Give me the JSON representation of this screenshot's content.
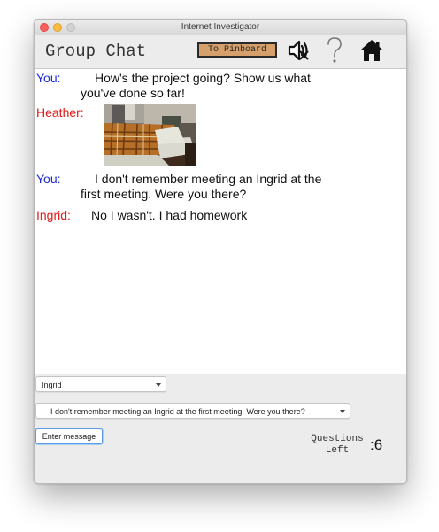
{
  "window": {
    "title": "Internet Investigator"
  },
  "header": {
    "title": "Group Chat",
    "pinboard_label": "To Pinboard",
    "icons": [
      "speaker-muted-icon",
      "question-mark-icon",
      "home-icon"
    ]
  },
  "colors": {
    "you": "#1a2ad6",
    "others": "#e01a1a",
    "pinboard_button": "#d6a06c"
  },
  "messages": [
    {
      "sender": "You:",
      "line1": "How's the project going? Show us what",
      "line2": "you've done so far!"
    },
    {
      "sender": "Heather:",
      "attachment": "photo-of-bedroom"
    },
    {
      "sender": "You:",
      "line1": "I don't remember meeting an Ingrid at the",
      "line2": "first meeting. Were you there?"
    },
    {
      "sender": "Ingrid:",
      "line1": "No I wasn't. I had homework"
    }
  ],
  "controls": {
    "recipient_selected": "Ingrid",
    "question_selected": "I don't remember meeting an Ingrid at the first meeting. Were you there?",
    "enter_label": "Enter message",
    "questions_left_label_1": "Questions",
    "questions_left_label_2": "Left",
    "questions_left_colon": ":",
    "questions_left_value": "6"
  }
}
